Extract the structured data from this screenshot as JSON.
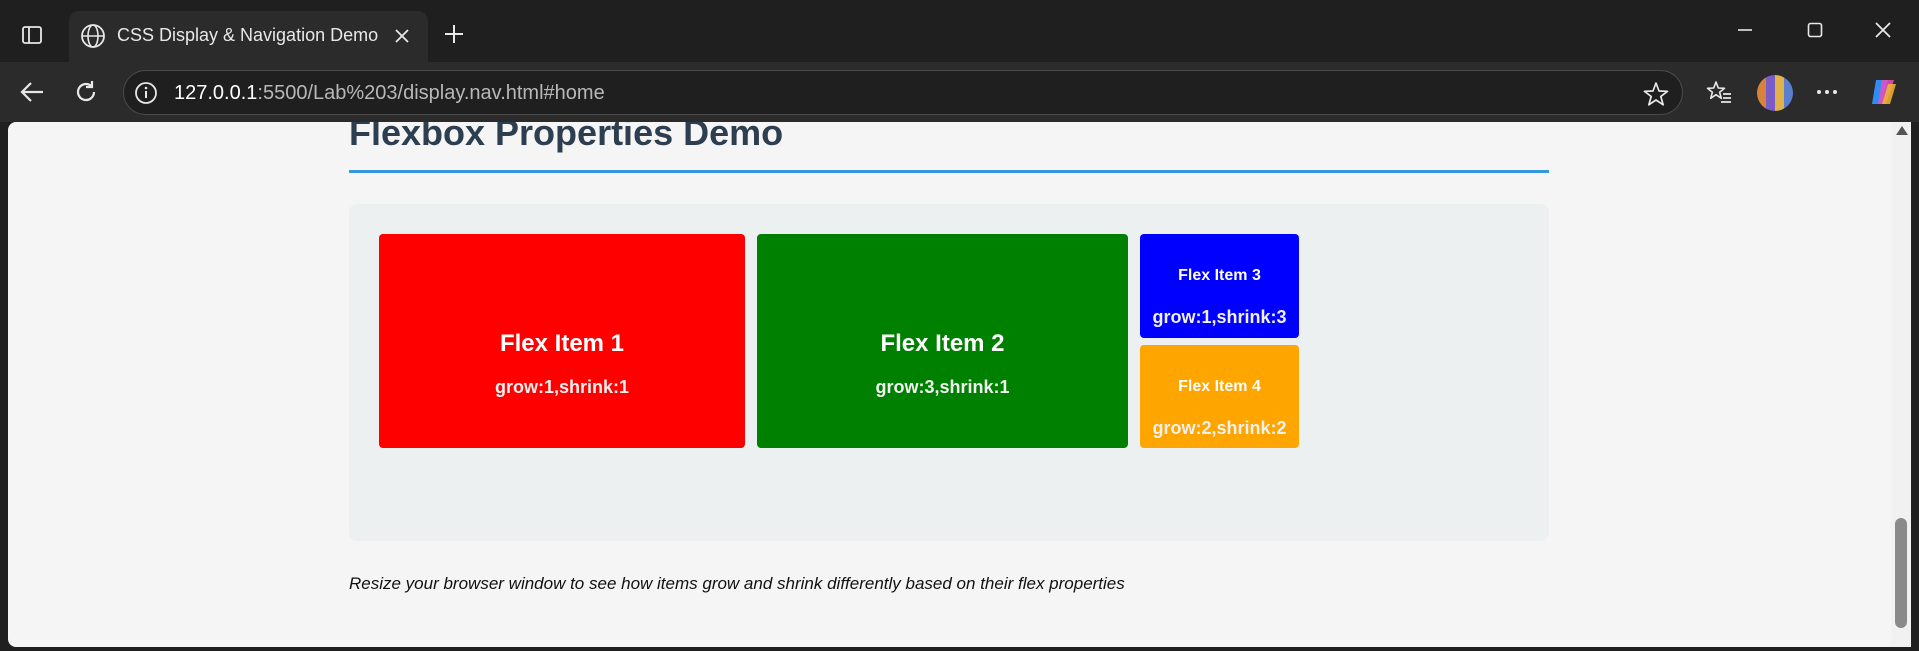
{
  "browser": {
    "tab_title": "CSS Display & Navigation Demo",
    "url_host": "127.0.0.1",
    "url_path": ":5500/Lab%203/display.nav.html#home"
  },
  "page": {
    "heading": "Flexbox Properties Demo",
    "items": [
      {
        "name": "Flex Item 1",
        "rule": "grow:1,shrink:1",
        "color": "#ff0000"
      },
      {
        "name": "Flex Item 2",
        "rule": "grow:3,shrink:1",
        "color": "#008000"
      },
      {
        "name": "Flex Item 3",
        "rule": "grow:1,shrink:3",
        "color": "#0000ff"
      },
      {
        "name": "Flex Item 4",
        "rule": "grow:2,shrink:2",
        "color": "#ffa500"
      }
    ],
    "note": "Resize your browser window to see how items grow and shrink differently based on their flex properties"
  },
  "colors": {
    "heading": "#2c3e50",
    "accent_rule": "#3498db",
    "container_bg": "#ecf0f1"
  },
  "icons": [
    "tab-actions-icon",
    "globe-icon",
    "close-icon",
    "plus-icon",
    "minimize-icon",
    "maximize-icon",
    "back-icon",
    "refresh-icon",
    "info-icon",
    "star-icon",
    "favorites-icon",
    "more-icon",
    "copilot-icon"
  ]
}
